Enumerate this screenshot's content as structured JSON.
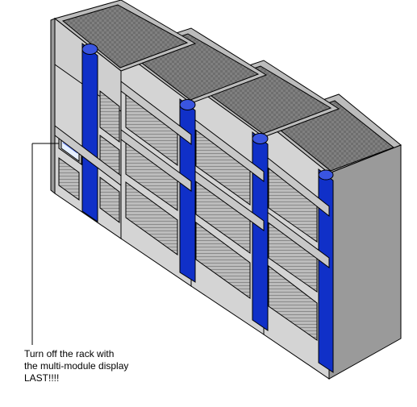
{
  "callout": {
    "text": "Turn off the rack with the multi-module display LAST!!!!"
  },
  "diagram": {
    "object": "server-rack-system",
    "rack_count": 4,
    "display_module_on_rack": 1
  },
  "colors": {
    "outline": "#000000",
    "panel_light": "#d4d4d4",
    "panel_mid": "#bcbcbc",
    "panel_dark": "#9a9a9a",
    "vent": "#808080",
    "accent": "#1030c8",
    "accent_dark": "#081a80",
    "display_bg": "#e6f0ff"
  }
}
